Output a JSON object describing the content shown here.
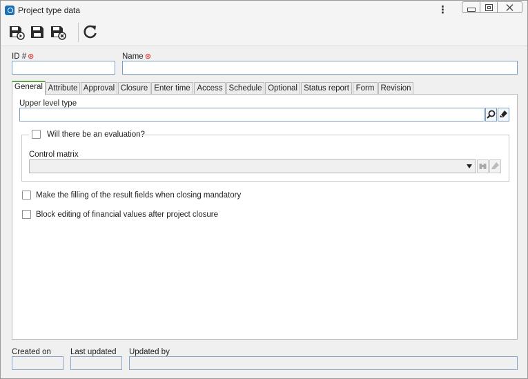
{
  "window": {
    "title": "Project type data",
    "icon": "app-icon",
    "menu_icon": "kebab-menu-icon",
    "minimize_icon": "minimize-icon",
    "maximize_icon": "maximize-icon",
    "close_icon": "close-icon"
  },
  "toolbar": {
    "buttons": [
      {
        "name": "save-and-new-button",
        "icon": "save-new-icon"
      },
      {
        "name": "save-button",
        "icon": "save-icon"
      },
      {
        "name": "save-and-close-button",
        "icon": "save-close-icon"
      },
      {
        "name": "refresh-button",
        "icon": "refresh-icon"
      }
    ]
  },
  "header": {
    "id_label": "ID #",
    "id_value": "",
    "name_label": "Name",
    "name_value": "",
    "required_marker": "⊛"
  },
  "tabs": [
    {
      "label": "General",
      "active": true
    },
    {
      "label": "Attribute"
    },
    {
      "label": "Approval"
    },
    {
      "label": "Closure"
    },
    {
      "label": "Enter time"
    },
    {
      "label": "Access"
    },
    {
      "label": "Schedule"
    },
    {
      "label": "Optional"
    },
    {
      "label": "Status report"
    },
    {
      "label": "Form"
    },
    {
      "label": "Revision"
    }
  ],
  "general": {
    "upper_level_type_label": "Upper level type",
    "upper_level_type_value": "",
    "evaluation_label": "Will there be an evaluation?",
    "evaluation_checked": false,
    "control_matrix_label": "Control matrix",
    "control_matrix_value": "",
    "mandatory_result_label": "Make the filling of the result fields when closing mandatory",
    "mandatory_result_checked": false,
    "block_financial_label": "Block editing of financial values after project closure",
    "block_financial_checked": false
  },
  "footer": {
    "created_on_label": "Created on",
    "created_on_value": "",
    "last_updated_label": "Last updated",
    "last_updated_value": "",
    "updated_by_label": "Updated by",
    "updated_by_value": ""
  },
  "colors": {
    "accent_tab": "#5fa64a",
    "input_border": "#7a9cc0",
    "required": "#d62020",
    "app_icon": "#1b6fb5"
  }
}
